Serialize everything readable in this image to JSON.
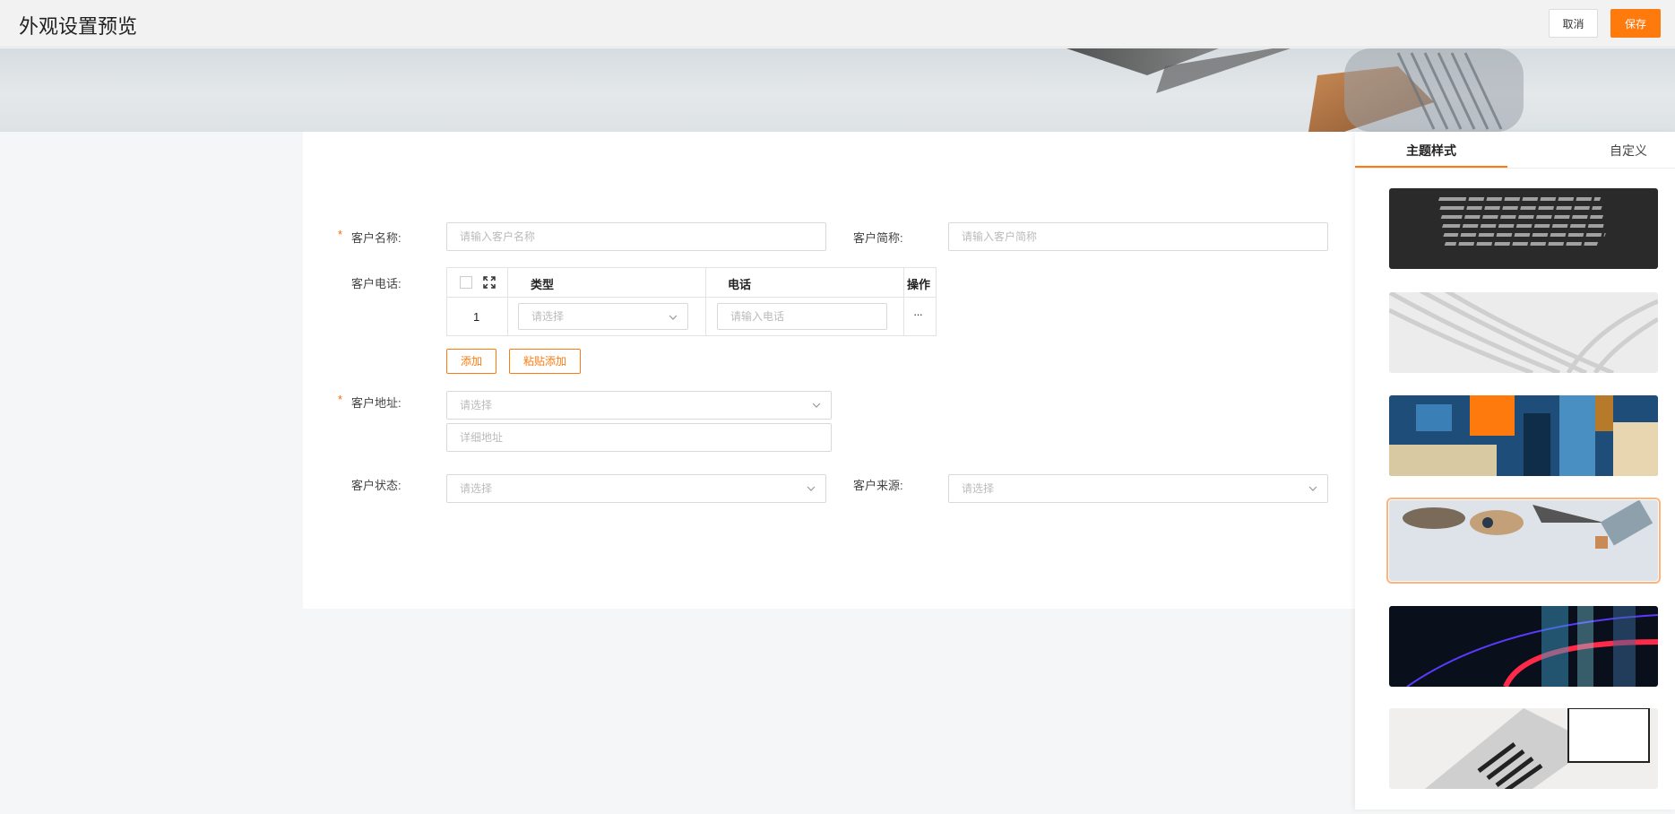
{
  "header": {
    "title": "外观设置预览",
    "cancel_label": "取消",
    "save_label": "保存"
  },
  "form": {
    "customer_name": {
      "label": "客户名称:",
      "required_mark": "*",
      "placeholder": "请输入客户名称"
    },
    "customer_short": {
      "label": "客户简称:",
      "placeholder": "请输入客户简称"
    },
    "customer_phone": {
      "label": "客户电话:",
      "columns": [
        "类型",
        "电话",
        "操作"
      ],
      "rows": [
        {
          "index": "1",
          "type_placeholder": "请选择",
          "phone_placeholder": "请输入电话",
          "actions": "···"
        }
      ],
      "add_label": "添加",
      "paste_add_label": "粘贴添加"
    },
    "customer_address": {
      "label": "客户地址:",
      "required_mark": "*",
      "select_placeholder": "请选择",
      "detail_placeholder": "详细地址"
    },
    "customer_status": {
      "label": "客户状态:",
      "placeholder": "请选择"
    },
    "customer_source": {
      "label": "客户来源:",
      "placeholder": "请选择"
    }
  },
  "panel": {
    "tabs": [
      "主题样式",
      "自定义"
    ],
    "active_tab": 0,
    "themes": [
      "keyboard",
      "white-curves",
      "abstract-paint",
      "craft-tools",
      "neon-light",
      "laptop-desk"
    ],
    "selected_theme": 3
  },
  "colors": {
    "accent": "#ff7a0d",
    "header_bg": "#f2f2f2",
    "page_bg": "#f5f6f7"
  }
}
